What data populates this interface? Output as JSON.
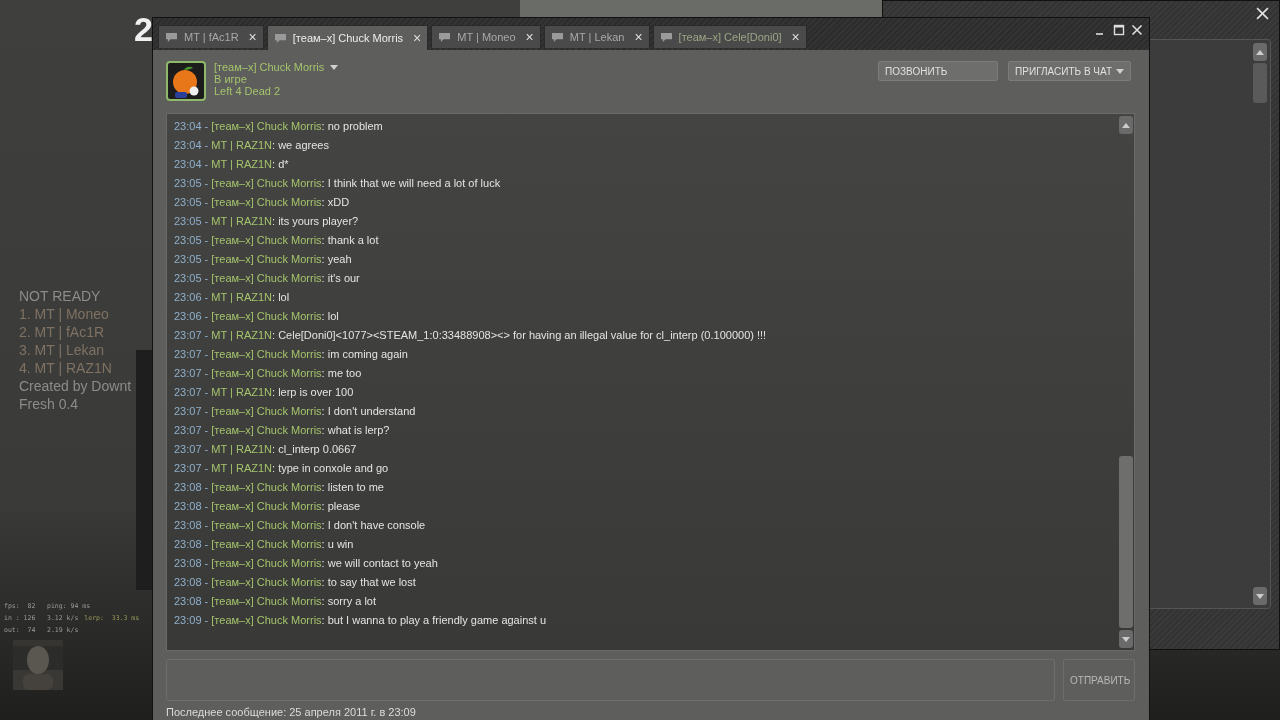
{
  "game_hud": {
    "round_number": "2",
    "ready_title": "NOT READY",
    "players": [
      "1. MT | Moneo",
      "2. MT | fAc1R",
      "3. MT | Lekan",
      "4. MT | RAZ1N"
    ],
    "credits": [
      "Created by Downt",
      "Fresh 0.4"
    ],
    "net_graph": [
      "fps:  82   ping: 94 ms",
      "in : 126   3.12 k/s",
      "lerp:  33.3 ms",
      "out:  74   2.19 k/s"
    ]
  },
  "chat_window": {
    "tabs": [
      {
        "label": "MT | fAc1R",
        "selected": false,
        "in_game": false
      },
      {
        "label": "[теам–x] Chuck Morris",
        "selected": true,
        "in_game": true
      },
      {
        "label": "MT | Moneo",
        "selected": false,
        "in_game": false
      },
      {
        "label": "MT | Lekan",
        "selected": false,
        "in_game": false
      },
      {
        "label": "[теам–x] Cele[Doni0]",
        "selected": false,
        "in_game": true
      }
    ],
    "close_glyph": "×",
    "friend": {
      "name": "[теам–x] Chuck Morris",
      "status": "В игре",
      "game": "Left 4 Dead 2"
    },
    "buttons": {
      "call": "ПОЗВОНИТЬ",
      "invite": "ПРИГЛАСИТЬ В ЧАТ"
    },
    "messages": [
      {
        "time": "23:04 -",
        "sender": "[теам–x] Chuck Morris",
        "text": ": no problem"
      },
      {
        "time": "23:04 -",
        "sender": "MT | RAZ1N",
        "text": ": we agrees"
      },
      {
        "time": "23:04 -",
        "sender": "MT | RAZ1N",
        "text": ": d*"
      },
      {
        "time": "23:05 -",
        "sender": "[теам–x] Chuck Morris",
        "text": ": I think that we will need a lot of luck"
      },
      {
        "time": "23:05 -",
        "sender": "[теам–x] Chuck Morris",
        "text": ": xDD"
      },
      {
        "time": "23:05 -",
        "sender": "MT | RAZ1N",
        "text": ": its yours player?"
      },
      {
        "time": "23:05 -",
        "sender": "[теам–x] Chuck Morris",
        "text": ": thank a lot"
      },
      {
        "time": "23:05 -",
        "sender": "[теам–x] Chuck Morris",
        "text": ": yeah"
      },
      {
        "time": "23:05 -",
        "sender": "[теам–x] Chuck Morris",
        "text": ": it's our"
      },
      {
        "time": "23:06 -",
        "sender": "MT | RAZ1N",
        "text": ": lol"
      },
      {
        "time": "23:06 -",
        "sender": "[теам–x] Chuck Morris",
        "text": ": lol"
      },
      {
        "time": "23:07 -",
        "sender": "MT | RAZ1N",
        "text": ": Cele[Doni0]<1077><STEAM_1:0:33488908><> for having an illegal value for cl_interp (0.100000) !!!"
      },
      {
        "time": "23:07 -",
        "sender": "[теам–x] Chuck Morris",
        "text": ": im coming again"
      },
      {
        "time": "23:07 -",
        "sender": "[теам–x] Chuck Morris",
        "text": ": me too"
      },
      {
        "time": "23:07 -",
        "sender": "MT | RAZ1N",
        "text": ": lerp is over 100"
      },
      {
        "time": "23:07 -",
        "sender": "[теам–x] Chuck Morris",
        "text": ": I don't understand"
      },
      {
        "time": "23:07 -",
        "sender": "[теам–x] Chuck Morris",
        "text": ": what is lerp?"
      },
      {
        "time": "23:07 -",
        "sender": "MT | RAZ1N",
        "text": ": cl_interp 0.0667"
      },
      {
        "time": "23:07 -",
        "sender": "MT | RAZ1N",
        "text": ": type in conxole and go"
      },
      {
        "time": "23:08 -",
        "sender": "[теам–x] Chuck Morris",
        "text": ": listen to me"
      },
      {
        "time": "23:08 -",
        "sender": "[теам–x] Chuck Morris",
        "text": ": please"
      },
      {
        "time": "23:08 -",
        "sender": "[теам–x] Chuck Morris",
        "text": ": I don't have console"
      },
      {
        "time": "23:08 -",
        "sender": "[теам–x] Chuck Morris",
        "text": ": u win"
      },
      {
        "time": "23:08 -",
        "sender": "[теам–x] Chuck Morris",
        "text": ": we will contact to yeah"
      },
      {
        "time": "23:08 -",
        "sender": "[теам–x] Chuck Morris",
        "text": ": to say that we lost"
      },
      {
        "time": "23:08 -",
        "sender": "[теам–x] Chuck Morris",
        "text": ": sorry a lot"
      },
      {
        "time": "23:09 -",
        "sender": "[теам–x] Chuck Morris",
        "text": ": but I wanna to play a friendly game against u"
      }
    ],
    "send_button": "ОТПРАВИТЬ",
    "last_message": "Последнее сообщение: 25 апреля 2011 г. в 23:09"
  }
}
